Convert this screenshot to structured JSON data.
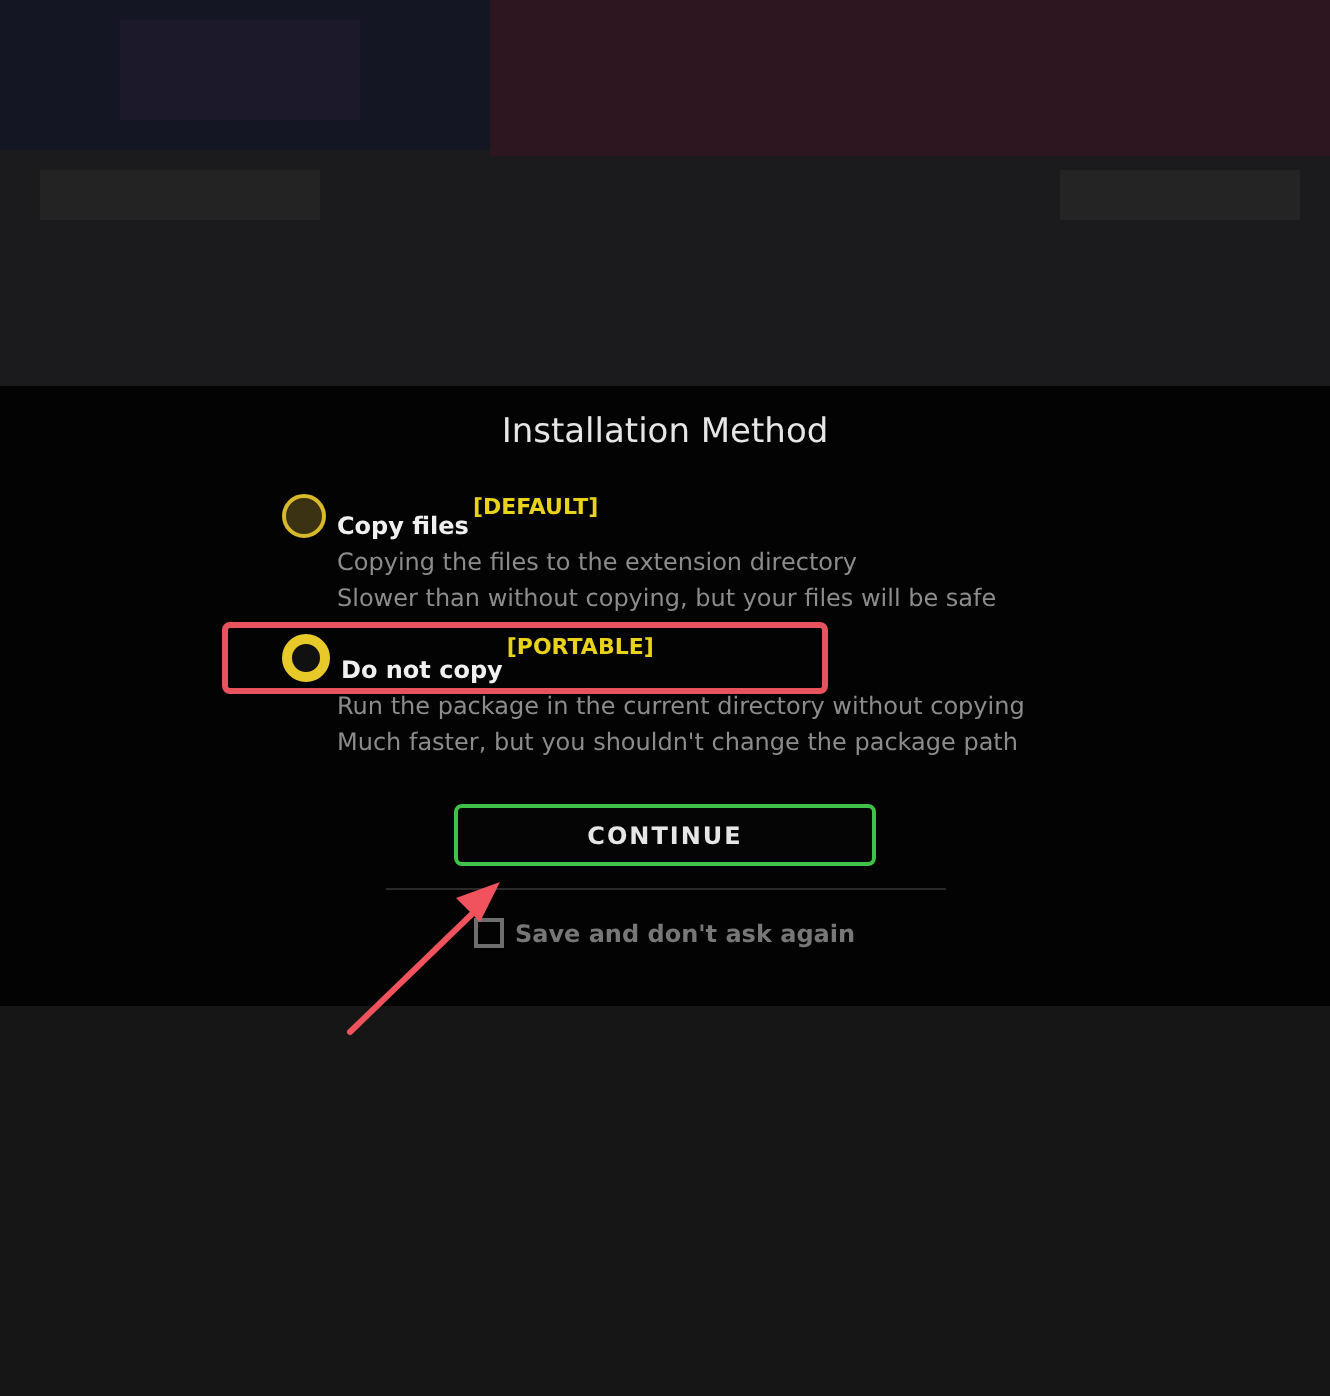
{
  "dialog": {
    "title": "Installation Method",
    "options": [
      {
        "label": "Copy files",
        "tag": "[DEFAULT]",
        "lines": [
          "Copying the files to the extension directory",
          "Slower than without copying, but your files will be safe"
        ],
        "selected": false,
        "highlighted": false
      },
      {
        "label": "Do not copy",
        "tag": "[PORTABLE]",
        "lines": [
          "Run the package in the current directory without copying",
          "Much faster, but you shouldn't change the package path"
        ],
        "selected": true,
        "highlighted": true
      }
    ],
    "button": "CONTINUE",
    "remember": {
      "label": "Save and don't ask again",
      "checked": false
    }
  },
  "annotation_arrow": true
}
